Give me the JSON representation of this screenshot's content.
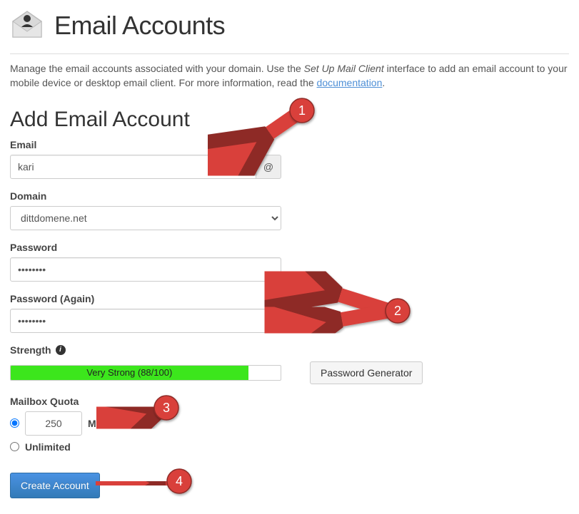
{
  "header": {
    "title": "Email Accounts"
  },
  "intro": {
    "prefix": "Manage the email accounts associated with your domain. Use the ",
    "em": "Set Up Mail Client",
    "mid": " interface to add an email account to your mobile device or desktop email client. For more information, read the ",
    "link": "documentation",
    "suffix": "."
  },
  "form": {
    "title": "Add Email Account",
    "email_label": "Email",
    "email_value": "kari",
    "at": "@",
    "domain_label": "Domain",
    "domain_value": "dittdomene.net",
    "password_label": "Password",
    "password_value": "••••••••",
    "password2_label": "Password (Again)",
    "password2_value": "••••••••",
    "strength_label": "Strength",
    "strength_text": "Very Strong (88/100)",
    "strength_pct": 88,
    "pwgen_label": "Password Generator",
    "quota_label": "Mailbox Quota",
    "quota_value": "250",
    "quota_unit": "MB",
    "quota_unlimited": "Unlimited",
    "submit": "Create Account"
  },
  "callouts": {
    "1": "1",
    "2": "2",
    "3": "3",
    "4": "4"
  }
}
